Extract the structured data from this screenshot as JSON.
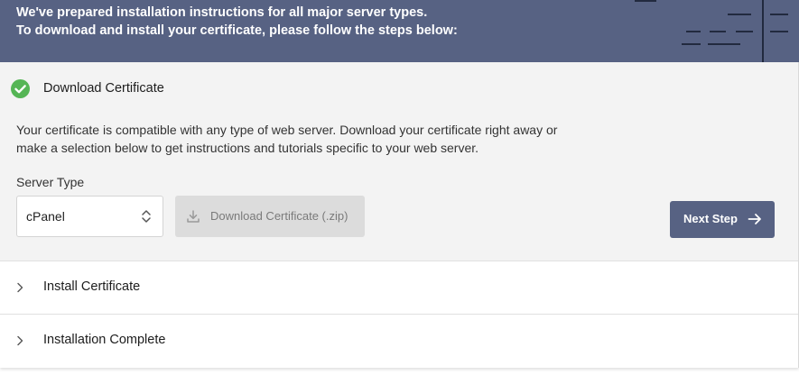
{
  "banner": {
    "line1": "We've prepared installation instructions for all major server types.",
    "line2": "To download and install your certificate, please follow the steps below:"
  },
  "steps": {
    "download": {
      "title": "Download Certificate",
      "status": "completed",
      "description": "Your certificate is compatible with any type of web server. Download your certificate right away or make a selection below to get instructions and tutorials specific to your web server.",
      "server_type_label": "Server Type",
      "server_type_value": "cPanel",
      "download_button": "Download Certificate (.zip)",
      "next_button": "Next Step"
    },
    "install": {
      "title": "Install Certificate"
    },
    "complete": {
      "title": "Installation Complete"
    }
  },
  "icons": {
    "check": "check-circle-icon",
    "select": "chevron-up-down-icon",
    "download": "download-icon",
    "next": "arrow-right-icon",
    "expand": "chevron-right-icon"
  },
  "colors": {
    "banner": "#576283",
    "success": "#55b555",
    "primary_button": "#576283",
    "disabled_button": "#dcdcdc"
  }
}
